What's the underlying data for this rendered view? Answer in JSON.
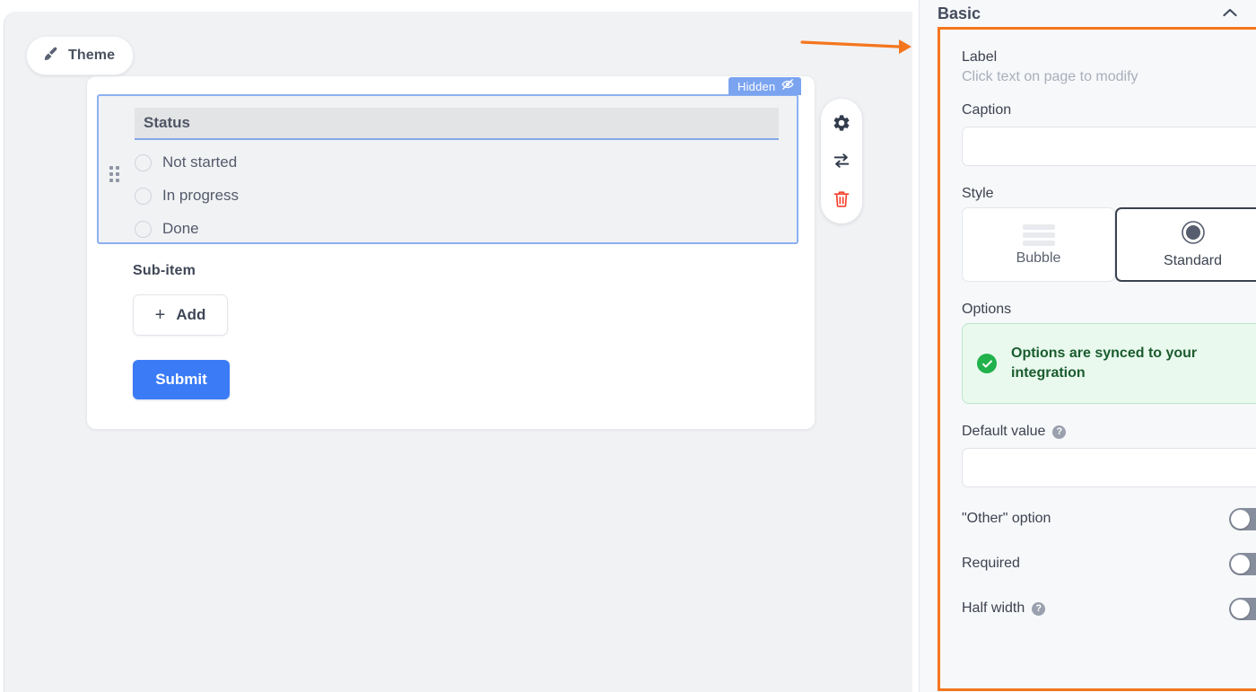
{
  "canvas": {
    "theme_button": {
      "label": "Theme",
      "icon": "paintbrush-icon"
    },
    "field": {
      "hidden_badge": {
        "label": "Hidden",
        "icon": "eye-off-icon"
      },
      "label_text": "Status",
      "options": [
        {
          "label": "Not started"
        },
        {
          "label": "In progress"
        },
        {
          "label": "Done"
        }
      ],
      "toolbar": [
        {
          "name": "settings",
          "icon": "gear-icon"
        },
        {
          "name": "swap",
          "icon": "swap-arrows-icon"
        },
        {
          "name": "delete",
          "icon": "trash-icon"
        }
      ]
    },
    "sub_item": {
      "label": "Sub-item",
      "add_button": {
        "label": "Add",
        "icon": "plus-icon"
      }
    },
    "submit_button": {
      "label": "Submit"
    }
  },
  "annotation": {
    "arrow_color": "#f4761d",
    "highlight_color": "#f4761d"
  },
  "panel": {
    "header": {
      "title": "Basic",
      "collapse_icon": "chevron-up-icon"
    },
    "label_field": {
      "label": "Label",
      "hint": "Click text on page to modify"
    },
    "caption_field": {
      "label": "Caption",
      "value": "",
      "placeholder": ""
    },
    "style_field": {
      "label": "Style",
      "options": [
        {
          "label": "Bubble",
          "icon": "stacked-bars-icon",
          "selected": false
        },
        {
          "label": "Standard",
          "icon": "radio-filled-icon",
          "selected": true
        }
      ]
    },
    "options_field": {
      "label": "Options",
      "banner": {
        "message": "Options are synced to your integration",
        "icon": "check-circle-icon",
        "bg_color": "#e9f9ee",
        "text_color": "#1a5c2e",
        "icon_color": "#21b24b"
      }
    },
    "default_value_field": {
      "label": "Default value",
      "help_icon": "question-mark-icon",
      "value": "",
      "placeholder": ""
    },
    "toggles": [
      {
        "label": "\"Other\" option",
        "on": false,
        "help_icon": null
      },
      {
        "label": "Required",
        "on": false,
        "help_icon": null
      },
      {
        "label": "Half width",
        "on": false,
        "help_icon": "question-mark-icon"
      }
    ]
  }
}
